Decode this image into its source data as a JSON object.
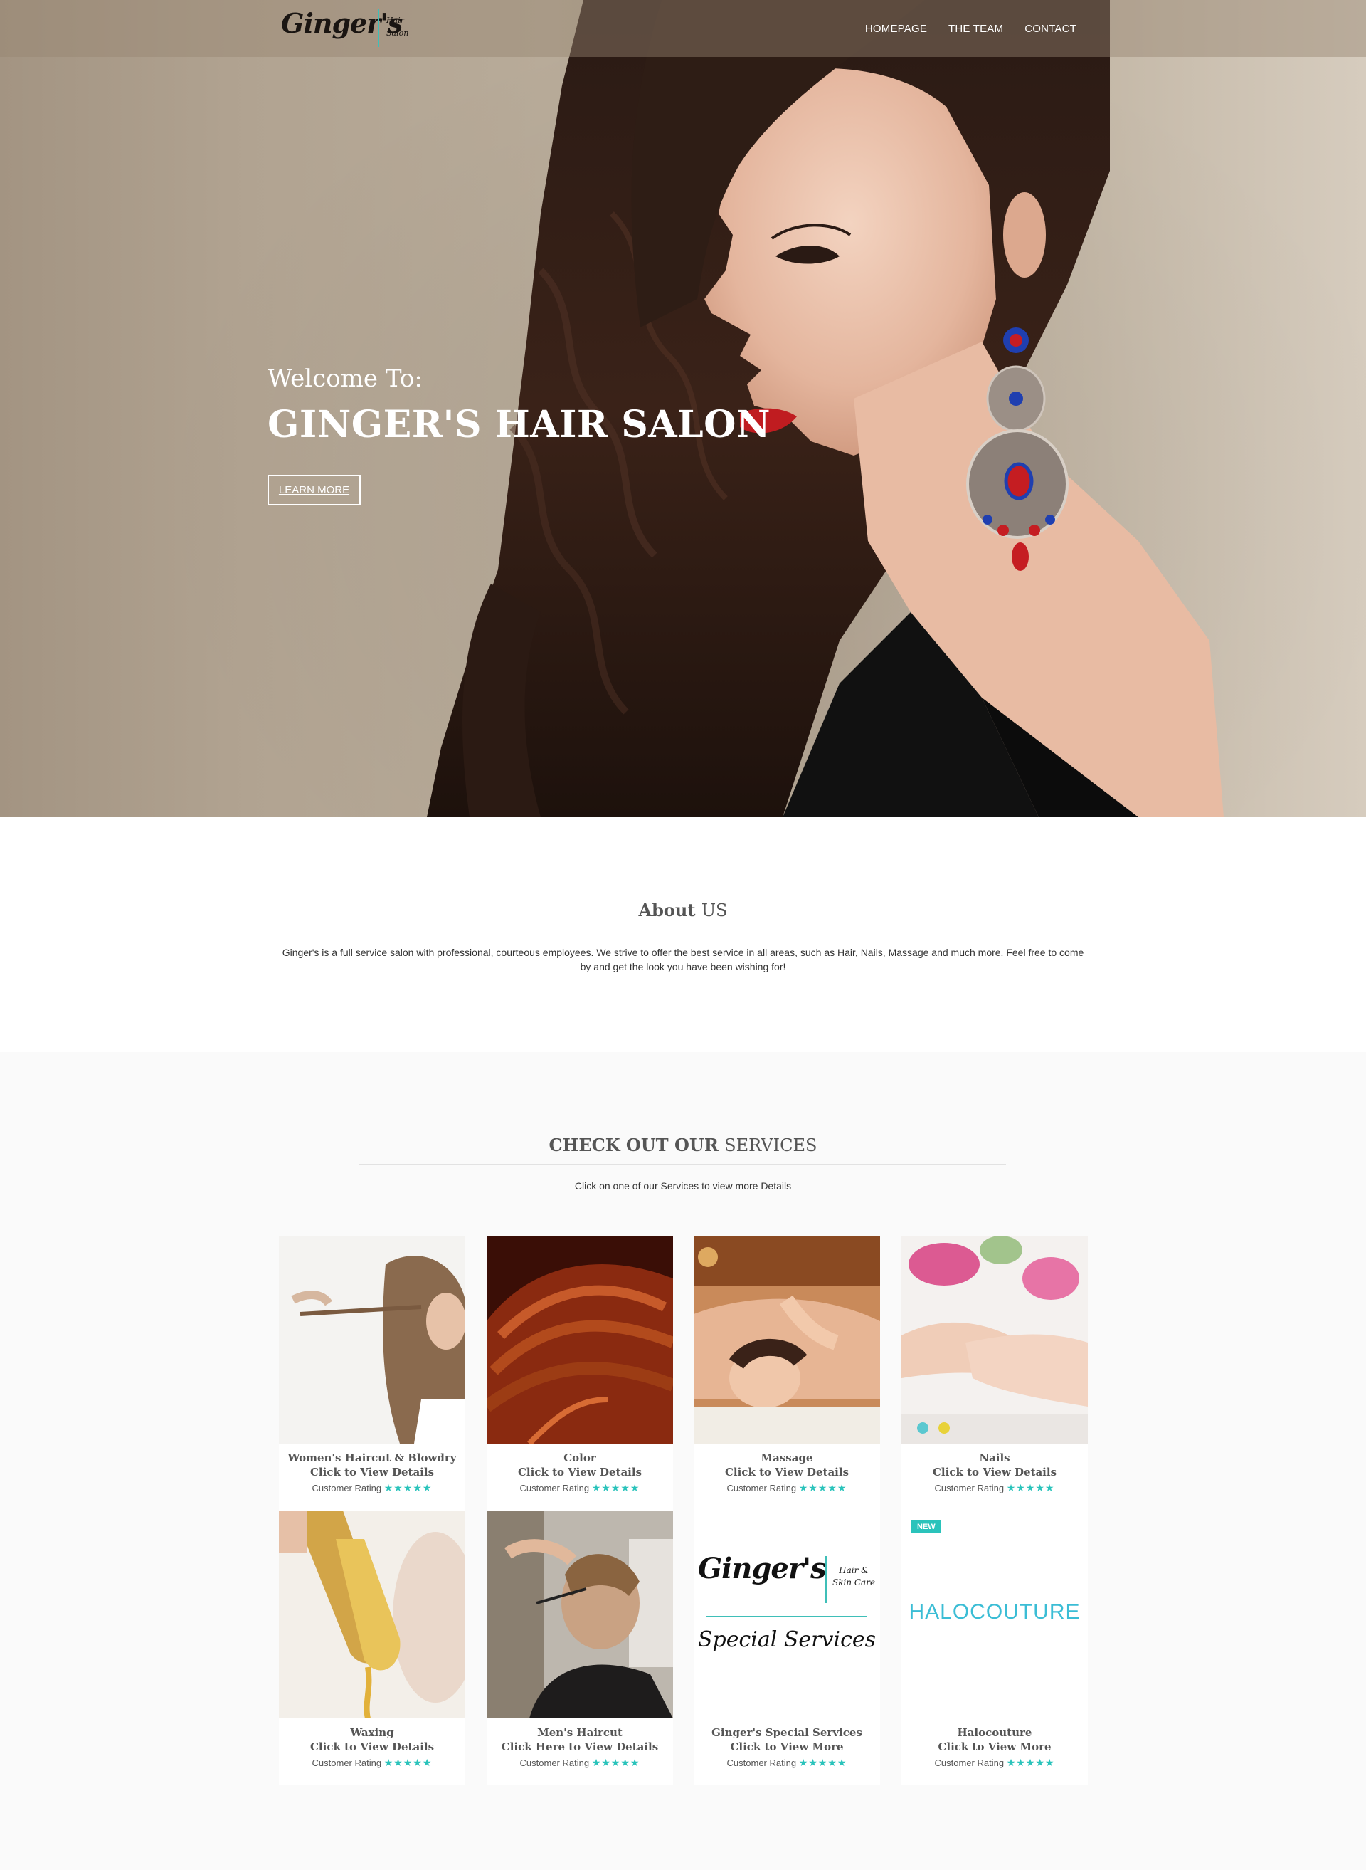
{
  "header": {
    "logo_text": "Ginger's",
    "logo_sub_1": "Hair",
    "logo_sub_2": "Salon",
    "nav": [
      {
        "label": "HOMEPAGE"
      },
      {
        "label": "THE TEAM"
      },
      {
        "label": "CONTACT"
      }
    ]
  },
  "hero": {
    "welcome": "Welcome To:",
    "title": "GINGER'S HAIR SALON",
    "button": "LEARN MORE"
  },
  "about": {
    "title_bold": "About",
    "title_light": "US",
    "text": "Ginger's is a full service salon with professional, courteous employees. We strive to offer the best service in all areas, such as Hair, Nails, Massage and much more. Feel free to come by and get the look you have been wishing for!"
  },
  "services": {
    "title_bold": "CHECK OUT OUR",
    "title_light": "SERVICES",
    "subtitle": "Click on one of our Services to view more Details",
    "rating_label": "Customer Rating",
    "stars": "★★★★★",
    "items": [
      {
        "name": "Women's Haircut & Blowdry",
        "action": "Click to View Details",
        "rating": 5
      },
      {
        "name": "Color",
        "action": "Click to View Details",
        "rating": 5
      },
      {
        "name": "Massage",
        "action": "Click to View Details",
        "rating": 5
      },
      {
        "name": "Nails",
        "action": "Click to View Details",
        "rating": 5
      },
      {
        "name": "Waxing",
        "action": "Click to View Details",
        "rating": 5
      },
      {
        "name": "Men's Haircut",
        "action": "Click Here to View Details",
        "rating": 5
      },
      {
        "name": "Ginger's Special Services",
        "action": "Click to View More",
        "rating": 5,
        "logo_main": "Ginger's",
        "logo_sub_1": "Hair &",
        "logo_sub_2": "Skin Care",
        "logo_script": "Special Services"
      },
      {
        "name": "Halocouture",
        "action": "Click to View More",
        "rating": 5,
        "badge": "NEW",
        "brand_a": "HALO",
        "brand_b": "COUTURE"
      }
    ]
  },
  "colors": {
    "accent": "#2ac3bb",
    "hero_bg": "#b3a593",
    "heading": "#555555"
  }
}
